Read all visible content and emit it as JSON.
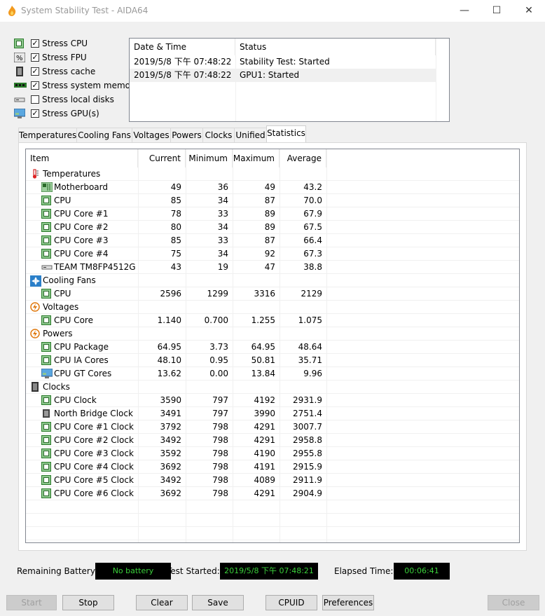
{
  "window": {
    "title": "System Stability Test - AIDA64",
    "minimize": "—",
    "maximize": "☐",
    "close": "✕"
  },
  "stress": [
    {
      "label": "Stress CPU",
      "checked": "✓",
      "icon": "cpu-chip-icon"
    },
    {
      "label": "Stress FPU",
      "checked": "✓",
      "icon": "fpu-icon"
    },
    {
      "label": "Stress cache",
      "checked": "✓",
      "icon": "cache-icon"
    },
    {
      "label": "Stress system memory",
      "checked": "✓",
      "icon": "memory-icon"
    },
    {
      "label": "Stress local disks",
      "checked": "",
      "icon": "disk-icon"
    },
    {
      "label": "Stress GPU(s)",
      "checked": "✓",
      "icon": "gpu-monitor-icon"
    }
  ],
  "log": {
    "col_datetime": "Date & Time",
    "col_status": "Status",
    "rows": [
      {
        "datetime": "2019/5/8 下午 07:48:22",
        "status": "Stability Test: Started"
      },
      {
        "datetime": "2019/5/8 下午 07:48:22",
        "status": "GPU1: Started"
      }
    ]
  },
  "tabs": [
    "Temperatures",
    "Cooling Fans",
    "Voltages",
    "Powers",
    "Clocks",
    "Unified",
    "Statistics"
  ],
  "stats": {
    "headers": {
      "item": "Item",
      "current": "Current",
      "minimum": "Minimum",
      "maximum": "Maximum",
      "average": "Average"
    },
    "rows": [
      {
        "type": "group",
        "name": "Temperatures",
        "icon": "thermometer-icon"
      },
      {
        "type": "item",
        "name": "Motherboard",
        "icon": "motherboard-icon",
        "cur": "49",
        "min": "36",
        "max": "49",
        "avg": "43.2"
      },
      {
        "type": "item",
        "name": "CPU",
        "icon": "cpu-chip-icon",
        "cur": "85",
        "min": "34",
        "max": "87",
        "avg": "70.0"
      },
      {
        "type": "item",
        "name": "CPU Core #1",
        "icon": "cpu-chip-icon",
        "cur": "78",
        "min": "33",
        "max": "89",
        "avg": "67.9"
      },
      {
        "type": "item",
        "name": "CPU Core #2",
        "icon": "cpu-chip-icon",
        "cur": "80",
        "min": "34",
        "max": "89",
        "avg": "67.5"
      },
      {
        "type": "item",
        "name": "CPU Core #3",
        "icon": "cpu-chip-icon",
        "cur": "85",
        "min": "33",
        "max": "87",
        "avg": "66.4"
      },
      {
        "type": "item",
        "name": "CPU Core #4",
        "icon": "cpu-chip-icon",
        "cur": "75",
        "min": "34",
        "max": "92",
        "avg": "67.3"
      },
      {
        "type": "item",
        "name": "TEAM TM8FP4512G",
        "icon": "disk-icon",
        "cur": "43",
        "min": "19",
        "max": "47",
        "avg": "38.8"
      },
      {
        "type": "group",
        "name": "Cooling Fans",
        "icon": "fan-icon"
      },
      {
        "type": "item",
        "name": "CPU",
        "icon": "cpu-chip-icon",
        "cur": "2596",
        "min": "1299",
        "max": "3316",
        "avg": "2129"
      },
      {
        "type": "group",
        "name": "Voltages",
        "icon": "voltage-icon"
      },
      {
        "type": "item",
        "name": "CPU Core",
        "icon": "cpu-chip-icon",
        "cur": "1.140",
        "min": "0.700",
        "max": "1.255",
        "avg": "1.075"
      },
      {
        "type": "group",
        "name": "Powers",
        "icon": "power-icon"
      },
      {
        "type": "item",
        "name": "CPU Package",
        "icon": "cpu-chip-icon",
        "cur": "64.95",
        "min": "3.73",
        "max": "64.95",
        "avg": "48.64"
      },
      {
        "type": "item",
        "name": "CPU IA Cores",
        "icon": "cpu-chip-icon",
        "cur": "48.10",
        "min": "0.95",
        "max": "50.81",
        "avg": "35.71"
      },
      {
        "type": "item",
        "name": "CPU GT Cores",
        "icon": "gpu-monitor-icon",
        "cur": "13.62",
        "min": "0.00",
        "max": "13.84",
        "avg": "9.96"
      },
      {
        "type": "group",
        "name": "Clocks",
        "icon": "clock-chip-icon"
      },
      {
        "type": "item",
        "name": "CPU Clock",
        "icon": "cpu-chip-icon",
        "cur": "3590",
        "min": "797",
        "max": "4192",
        "avg": "2931.9"
      },
      {
        "type": "item",
        "name": "North Bridge Clock",
        "icon": "northbridge-icon",
        "cur": "3491",
        "min": "797",
        "max": "3990",
        "avg": "2751.4"
      },
      {
        "type": "item",
        "name": "CPU Core #1 Clock",
        "icon": "cpu-chip-icon",
        "cur": "3792",
        "min": "798",
        "max": "4291",
        "avg": "3007.7"
      },
      {
        "type": "item",
        "name": "CPU Core #2 Clock",
        "icon": "cpu-chip-icon",
        "cur": "3492",
        "min": "798",
        "max": "4291",
        "avg": "2958.8"
      },
      {
        "type": "item",
        "name": "CPU Core #3 Clock",
        "icon": "cpu-chip-icon",
        "cur": "3592",
        "min": "798",
        "max": "4190",
        "avg": "2955.8"
      },
      {
        "type": "item",
        "name": "CPU Core #4 Clock",
        "icon": "cpu-chip-icon",
        "cur": "3692",
        "min": "798",
        "max": "4191",
        "avg": "2915.9"
      },
      {
        "type": "item",
        "name": "CPU Core #5 Clock",
        "icon": "cpu-chip-icon",
        "cur": "3492",
        "min": "798",
        "max": "4089",
        "avg": "2911.9"
      },
      {
        "type": "item",
        "name": "CPU Core #6 Clock",
        "icon": "cpu-chip-icon",
        "cur": "3692",
        "min": "798",
        "max": "4291",
        "avg": "2904.9"
      }
    ]
  },
  "status": {
    "battery_label": "Remaining Battery:",
    "battery_value": "No battery",
    "started_label": "Test Started:",
    "started_value": "2019/5/8 下午 07:48:21",
    "elapsed_label": "Elapsed Time:",
    "elapsed_value": "00:06:41"
  },
  "buttons": {
    "start": "Start",
    "stop": "Stop",
    "clear": "Clear",
    "save": "Save",
    "cpuid": "CPUID",
    "preferences": "Preferences",
    "close": "Close"
  }
}
